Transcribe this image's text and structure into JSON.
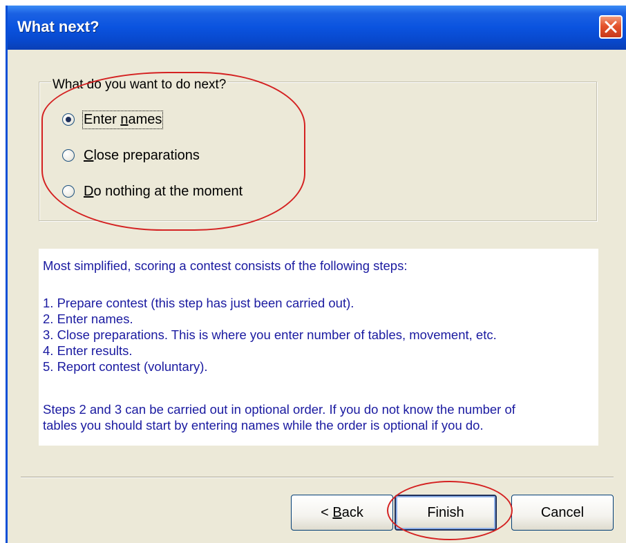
{
  "window": {
    "title": "What next?",
    "close_icon": "close-icon",
    "colors": {
      "titlebar": "#0a53df",
      "close": "#e4532b",
      "body": "#ece9d8",
      "info_text": "#1a1aa0",
      "annotation": "#d42121"
    }
  },
  "group": {
    "legend": "What do you want to do next?",
    "options": [
      {
        "label_pre": "Enter ",
        "mnemonic": "n",
        "label_post": "ames",
        "checked": true
      },
      {
        "label_pre": "",
        "mnemonic": "C",
        "label_post": "lose preparations",
        "checked": false
      },
      {
        "label_pre": "",
        "mnemonic": "D",
        "label_post": "o nothing at the moment",
        "checked": false
      }
    ]
  },
  "info": {
    "intro": "Most simplified, scoring a contest consists of the following steps:",
    "steps": [
      "1. Prepare contest (this step has just been carried out).",
      "2. Enter names.",
      "3. Close preparations. This is where you enter number of tables, movement, etc.",
      "4. Enter results.",
      "5. Report contest (voluntary)."
    ],
    "note_line1": "Steps 2 and 3 can be carried out in optional order. If you do not know the number of",
    "note_line2": "tables you should start by entering names while the order is optional if you do."
  },
  "buttons": {
    "back_prefix": "< ",
    "back_mnemonic": "B",
    "back_rest": "ack",
    "finish": "Finish",
    "cancel": "Cancel"
  }
}
